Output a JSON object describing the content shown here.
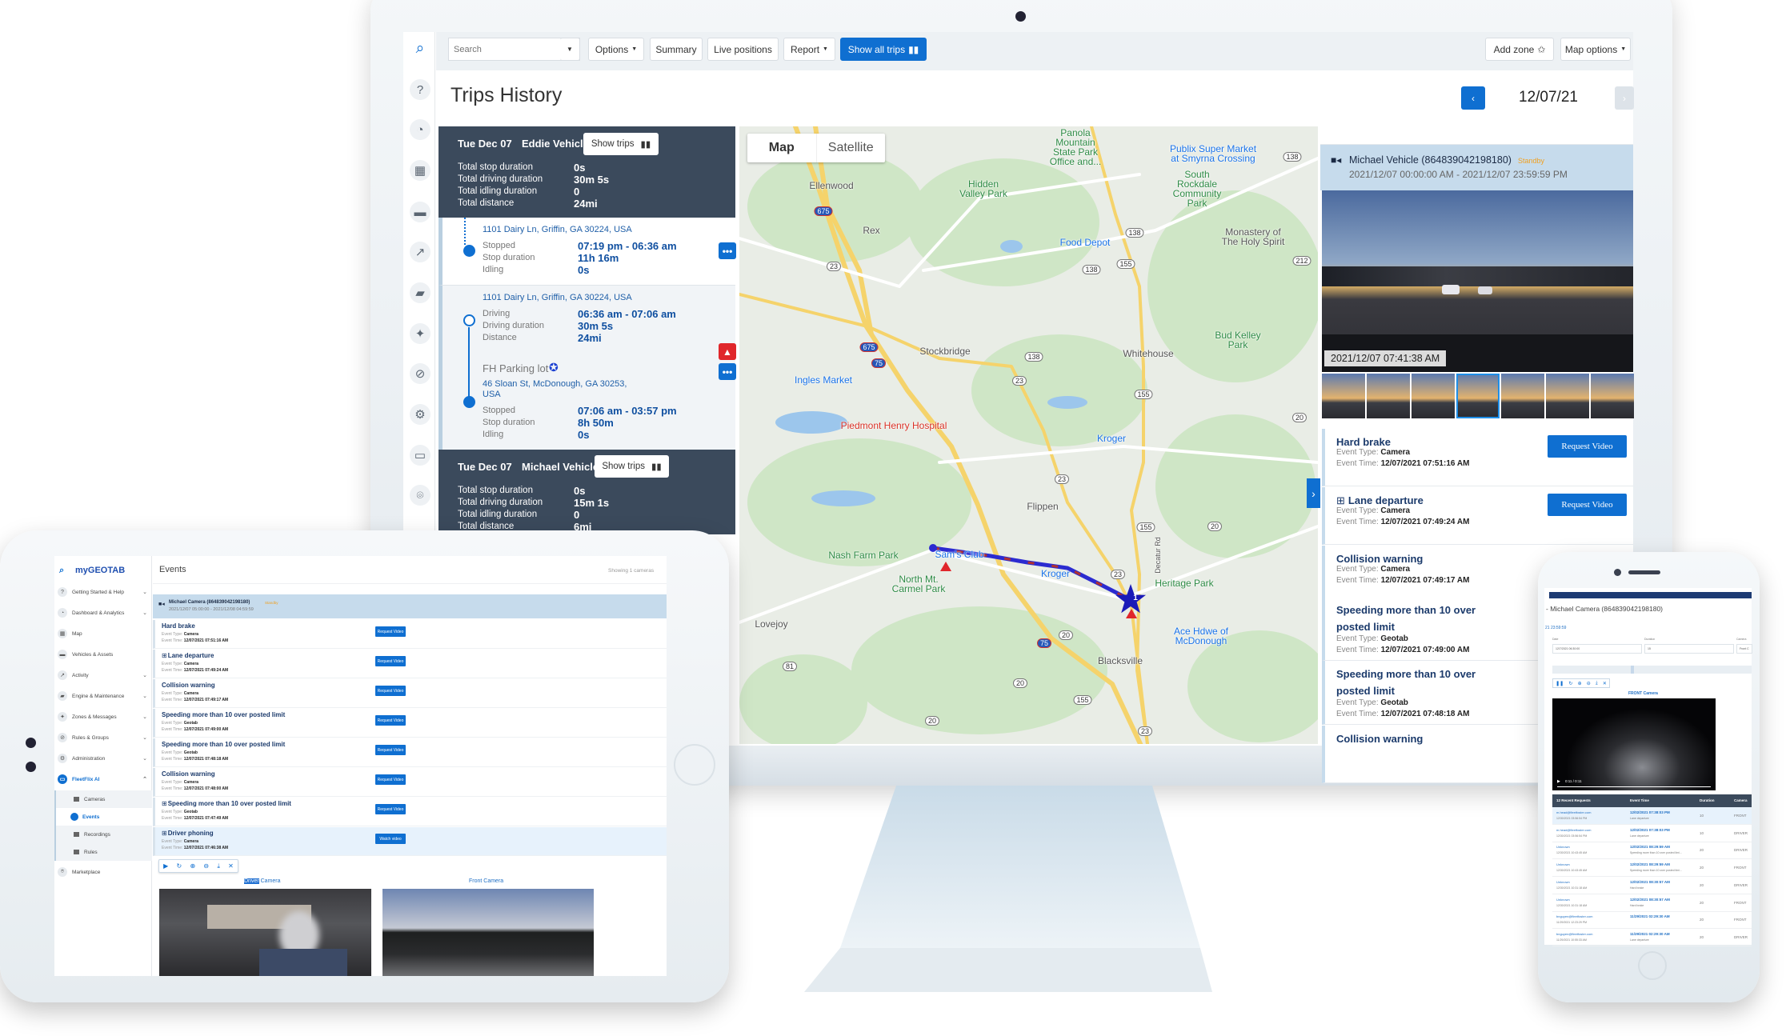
{
  "monitor": {
    "toolbar": {
      "search_placeholder": "Search",
      "options": "Options",
      "summary": "Summary",
      "live_positions": "Live positions",
      "report": "Report",
      "show_all_trips": "Show all trips",
      "add_zone": "Add zone",
      "map_options": "Map options"
    },
    "title": "Trips History",
    "date": "12/07/21",
    "trips": [
      {
        "date": "Tue Dec 07",
        "vehicle": "Eddie Vehicle",
        "show_trips": "Show trips",
        "stats": [
          {
            "label": "Total stop duration",
            "value": "0s"
          },
          {
            "label": "Total driving duration",
            "value": "30m 5s"
          },
          {
            "label": "Total idling duration",
            "value": "0"
          },
          {
            "label": "Total distance",
            "value": "24mi"
          }
        ],
        "stop1": {
          "address": "1101 Dairy Ln, Griffin, GA 30224, USA",
          "rows": [
            {
              "label": "Stopped",
              "value": "07:19 pm - 06:36 am"
            },
            {
              "label": "Stop duration",
              "value": "11h 16m"
            },
            {
              "label": "Idling",
              "value": "0s"
            }
          ]
        },
        "drive": {
          "address": "1101 Dairy Ln, Griffin, GA 30224, USA",
          "rows": [
            {
              "label": "Driving",
              "value": "06:36 am - 07:06 am"
            },
            {
              "label": "Driving duration",
              "value": "30m 5s"
            },
            {
              "label": "Distance",
              "value": "24mi"
            }
          ]
        },
        "stop2": {
          "zone": "FH Parking lot",
          "address_line1": "46 Sloan St, McDonough, GA 30253,",
          "address_line2": "USA",
          "rows": [
            {
              "label": "Stopped",
              "value": "07:06 am - 03:57 pm"
            },
            {
              "label": "Stop duration",
              "value": "8h 50m"
            },
            {
              "label": "Idling",
              "value": "0s"
            }
          ]
        }
      },
      {
        "date": "Tue Dec 07",
        "vehicle": "Michael Vehicle",
        "show_trips": "Show trips",
        "stats": [
          {
            "label": "Total stop duration",
            "value": "0s"
          },
          {
            "label": "Total driving duration",
            "value": "15m 1s"
          },
          {
            "label": "Total idling duration",
            "value": "0"
          },
          {
            "label": "Total distance",
            "value": "6mi"
          }
        ]
      }
    ],
    "map": {
      "toggle": [
        "Map",
        "Satellite"
      ],
      "active_toggle": "Map",
      "labels": [
        {
          "text": "Panola\nMountain\nState Park\nOffice and...",
          "kind": "park"
        },
        {
          "text": "Ellenwood",
          "kind": "town"
        },
        {
          "text": "Hidden\nValley Park",
          "kind": "park"
        },
        {
          "text": "Publix Super Market\nat Smyrna Crossing",
          "kind": "store"
        },
        {
          "text": "South\nRockdale\nCommunity\nPark",
          "kind": "park"
        },
        {
          "text": "Rex",
          "kind": "town"
        },
        {
          "text": "Food Depot",
          "kind": "store"
        },
        {
          "text": "Monastery of\nThe Holy Spirit",
          "kind": "town"
        },
        {
          "text": "Stockbridge",
          "kind": "town"
        },
        {
          "text": "Whitehouse",
          "kind": "town"
        },
        {
          "text": "Bud Kelley\nPark",
          "kind": "park"
        },
        {
          "text": "Ingles Market",
          "kind": "store"
        },
        {
          "text": "Piedmont Henry Hospital",
          "kind": "hospital"
        },
        {
          "text": "Kroger",
          "kind": "store"
        },
        {
          "text": "Flippen",
          "kind": "town"
        },
        {
          "text": "Nash Farm Park",
          "kind": "park"
        },
        {
          "text": "North Mt.\nCarmel Park",
          "kind": "park"
        },
        {
          "text": "Sam's Club",
          "kind": "store"
        },
        {
          "text": "Kroger",
          "kind": "store"
        },
        {
          "text": "Heritage Park",
          "kind": "park"
        },
        {
          "text": "Ace Hdwe of\nMcDonough",
          "kind": "store"
        },
        {
          "text": "Blacksville",
          "kind": "town"
        },
        {
          "text": "Lovejoy",
          "kind": "town"
        },
        {
          "text": "Decatur Rd",
          "kind": "town"
        }
      ],
      "shields": [
        "675",
        "675",
        "75",
        "75",
        "23",
        "23",
        "23",
        "23",
        "23",
        "138",
        "138",
        "138",
        "138",
        "155",
        "155",
        "155",
        "155",
        "20",
        "20",
        "20",
        "20",
        "20",
        "212",
        "81"
      ],
      "marker_number": "1",
      "colors": {
        "park": "#2e8b45",
        "store": "#1a73e8",
        "hospital": "#d93025",
        "town": "#555555",
        "route": "#2b2bd0",
        "route_alt": "#b03030",
        "road": "#f5d36b"
      }
    },
    "right_panel": {
      "vehicle": "Michael Vehicle (864839042198180)",
      "status": "Standby",
      "range": "2021/12/07 00:00:00 AM - 2021/12/07 23:59:59 PM",
      "snapshot_time": "2021/12/07 07:41:38 AM",
      "thumbnail_selected": 4,
      "events": [
        {
          "title": "Hard brake",
          "type_label": "Event Type:",
          "type": "Camera",
          "time_label": "Event Time:",
          "time": "12/07/2021 07:51:16 AM",
          "button": "Request Video"
        },
        {
          "title": "Lane departure",
          "type_label": "Event Type:",
          "type": "Camera",
          "time_label": "Event Time:",
          "time": "12/07/2021 07:49:24 AM",
          "button": "Request Video",
          "plus": true
        },
        {
          "title": "Collision warning",
          "type_label": "Event Type:",
          "type": "Camera",
          "time_label": "Event Time:",
          "time": "12/07/2021 07:49:17 AM"
        },
        {
          "title": "Speeding more than 10 over posted limit",
          "type_label": "Event Type:",
          "type": "Geotab",
          "time_label": "Event Time:",
          "time": "12/07/2021 07:49:00 AM"
        },
        {
          "title": "Speeding more than 10 over posted limit",
          "type_label": "Event Type:",
          "type": "Geotab",
          "time_label": "Event Time:",
          "time": "12/07/2021 07:48:18 AM"
        },
        {
          "title": "Collision warning"
        }
      ]
    }
  },
  "tablet": {
    "logo": "myGEOTAB",
    "page_title": "Events",
    "showing": "Showing 1 cameras",
    "sidebar": [
      {
        "label": "Getting Started & Help",
        "icon": "?",
        "chevron": true
      },
      {
        "label": "Dashboard & Analytics",
        "icon": "◔",
        "chevron": true
      },
      {
        "label": "Map",
        "icon": "▦",
        "chevron": false
      },
      {
        "label": "Vehicles & Assets",
        "icon": "▬",
        "chevron": false
      },
      {
        "label": "Activity",
        "icon": "↗",
        "chevron": true
      },
      {
        "label": "Engine & Maintenance",
        "icon": "▰",
        "chevron": true
      },
      {
        "label": "Zones & Messages",
        "icon": "✦",
        "chevron": true
      },
      {
        "label": "Rules & Groups",
        "icon": "⊘",
        "chevron": true
      },
      {
        "label": "Administration",
        "icon": "⚙",
        "chevron": true
      },
      {
        "label": "FleetFlix AI",
        "icon": "▭",
        "chevron": true,
        "expanded": true
      }
    ],
    "subitems": [
      {
        "label": "Cameras"
      },
      {
        "label": "Events",
        "active": true
      },
      {
        "label": "Recordings"
      },
      {
        "label": "Rules"
      }
    ],
    "marketplace": "Marketplace",
    "camera": {
      "name": "Michael Camera (864839042198180)",
      "status": "Standby",
      "range": "2021/12/07 05:00:00 - 2021/12/08 04:59:59"
    },
    "events": [
      {
        "title": "Hard brake",
        "type": "Camera",
        "time": "12/07/2021 07:51:16 AM",
        "button": "Request Video"
      },
      {
        "title": "Lane departure",
        "type": "Camera",
        "time": "12/07/2021 07:49:24 AM",
        "button": "Request Video",
        "plus": true
      },
      {
        "title": "Collision warning",
        "type": "Camera",
        "time": "12/07/2021 07:49:17 AM",
        "button": "Request Video"
      },
      {
        "title": "Speeding more than 10 over posted limit",
        "type": "Geotab",
        "time": "12/07/2021 07:49:00 AM",
        "button": "Request Video"
      },
      {
        "title": "Speeding more than 10 over posted limit",
        "type": "Geotab",
        "time": "12/07/2021 07:48:18 AM",
        "button": "Request Video"
      },
      {
        "title": "Collision warning",
        "type": "Camera",
        "time": "12/07/2021 07:48:00 AM",
        "button": "Request Video"
      },
      {
        "title": "Speeding more than 10 over posted limit",
        "type": "Geotab",
        "time": "12/07/2021 07:47:49 AM",
        "button": "Request Video",
        "plus": true
      },
      {
        "title": "Driver phoning",
        "type": "Camera",
        "time": "12/07/2021 07:46:38 AM",
        "button": "Watch video",
        "plus": true,
        "highlight": true
      }
    ],
    "event_type_label": "Event Type:",
    "event_time_label": "Event Time:",
    "driver_camera_highlight": "Driver",
    "driver_camera_rest": " Camera",
    "front_camera": "Front Camera"
  },
  "phone": {
    "title": "- Michael Camera (864839042198180)",
    "range_tail": "21 23:59:59",
    "fields": [
      {
        "label": "Date",
        "value": "12/7/2021 06:30:00"
      },
      {
        "label": "Duration",
        "value": "15"
      },
      {
        "label": "Camera",
        "value": "Front C"
      }
    ],
    "camera_label": "FRONT Camera",
    "video_time": "0:11 / 0:11",
    "table_headers": [
      "12 Recent Requests",
      "Event Time",
      "Duration",
      "Camera"
    ],
    "rows": [
      {
        "user": "m.head@fleetfoster.com",
        "requested": "12/30/2021 03:56:54 PM",
        "event_time": "12/02/2021 07:38:03 PM",
        "event": "Lane departure",
        "duration": "10",
        "camera": "FRONT"
      },
      {
        "user": "m.head@fleetfoster.com",
        "requested": "12/30/2021 03:56:54 PM",
        "event_time": "12/02/2021 07:38:03 PM",
        "event": "Lane departure",
        "duration": "10",
        "camera": "DRIVER"
      },
      {
        "user": "Unknown",
        "requested": "12/30/2021 10:43:45 AM",
        "event_time": "12/02/2021 08:29:59 AM",
        "event": "Speeding more than 10 over posted limi...",
        "duration": "20",
        "camera": "DRIVER"
      },
      {
        "user": "Unknown",
        "requested": "12/30/2021 10:43:45 AM",
        "event_time": "12/02/2021 08:29:59 AM",
        "event": "Speeding more than 10 over posted limi...",
        "duration": "20",
        "camera": "FRONT"
      },
      {
        "user": "Unknown",
        "requested": "12/30/2021 10:31:18 AM",
        "event_time": "12/02/2021 08:30:57 AM",
        "event": "Hard brake",
        "duration": "20",
        "camera": "DRIVER"
      },
      {
        "user": "Unknown",
        "requested": "12/30/2021 10:31:18 AM",
        "event_time": "12/02/2021 08:30:57 AM",
        "event": "Hard brake",
        "duration": "20",
        "camera": "FRONT"
      },
      {
        "user": "bnguyen@fleetfoster.com",
        "requested": "11/29/2021 12:23:29 PM",
        "event_time": "11/29/2021 02:29:30 AM",
        "event": "",
        "duration": "20",
        "camera": "FRONT"
      },
      {
        "user": "bnguyen@fleetfoster.com",
        "requested": "11/29/2021 10:55:33 AM",
        "event_time": "11/29/2021 02:29:30 AM",
        "event": "Lane departure",
        "duration": "20",
        "camera": "DRIVER"
      }
    ]
  }
}
